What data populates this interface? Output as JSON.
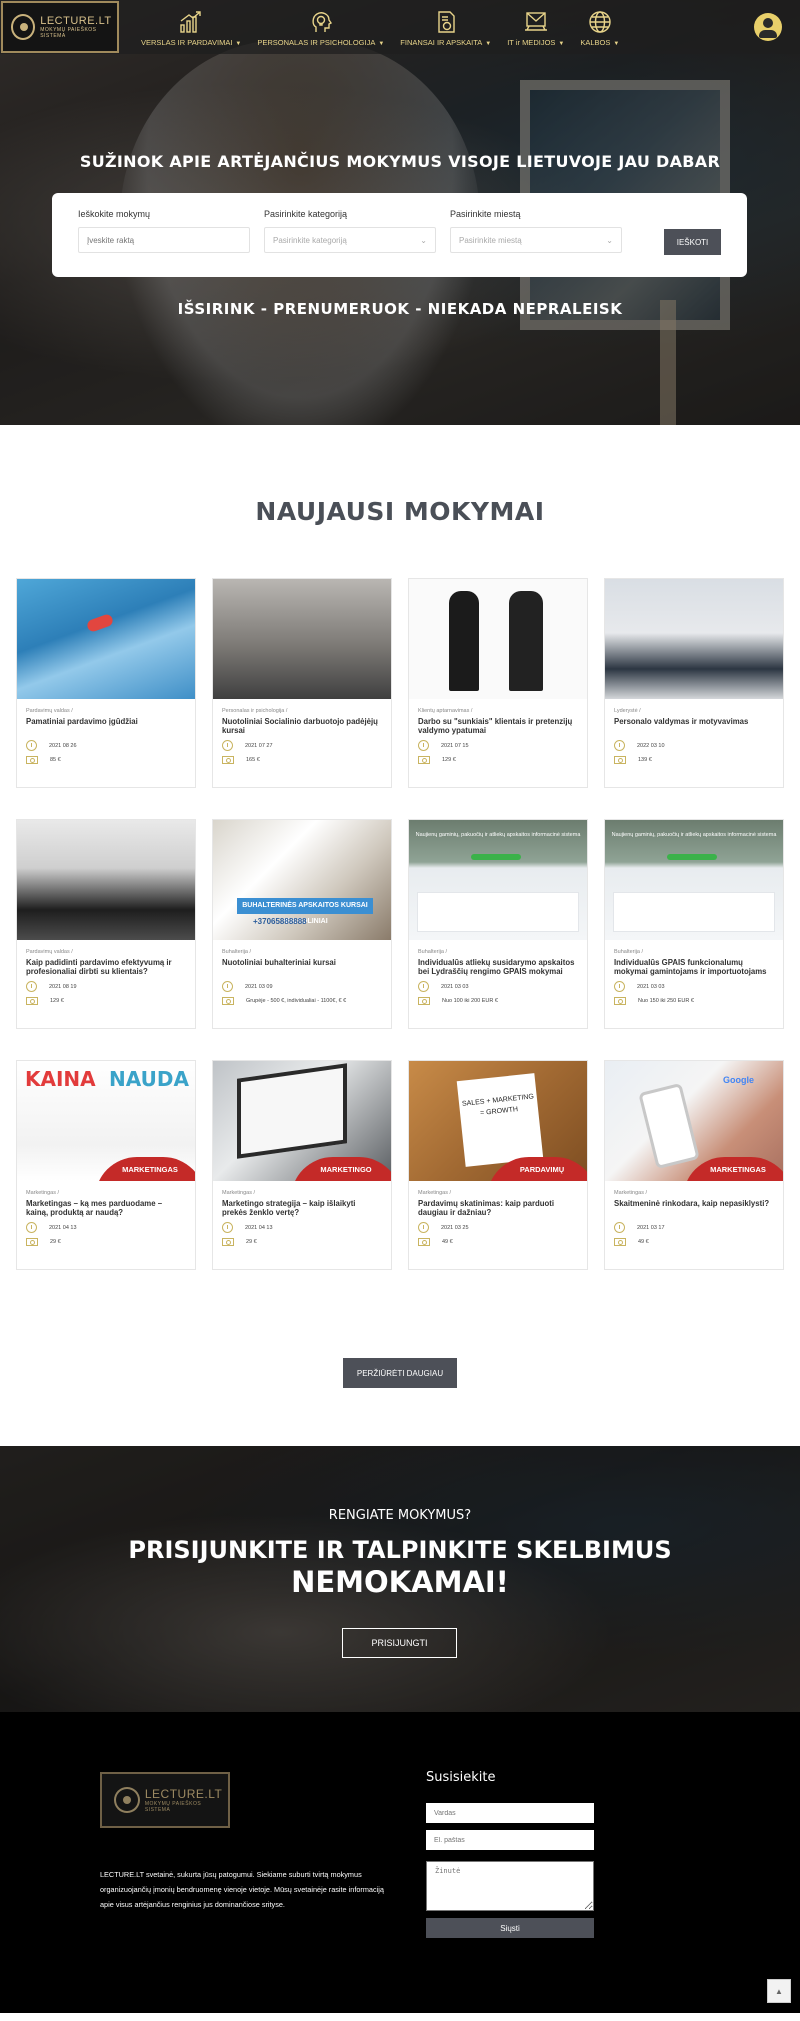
{
  "header": {
    "logo_text": "LECTURE.LT",
    "logo_tagline": "MOKYMŲ PAIEŠKOS SISTEMA",
    "nav": [
      {
        "label": "VERSLAS IR PARDAVIMAI",
        "icon": "chart-growth-icon"
      },
      {
        "label": "PERSONALAS IR PSICHOLOGIJA",
        "icon": "head-lightbulb-icon"
      },
      {
        "label": "FINANSAI IR APSKAITA",
        "icon": "document-money-icon"
      },
      {
        "label": "IT ir MEDIJOS",
        "icon": "laptop-envelope-icon"
      },
      {
        "label": "KALBOS",
        "icon": "globe-icon"
      }
    ],
    "user_icon": "user-account-icon"
  },
  "hero": {
    "title": "SUŽINOK APIE ARTĖJANČIUS MOKYMUS VISOJE LIETUVOJE JAU DABAR",
    "search": {
      "keyword_label": "Ieškokite mokymų",
      "keyword_placeholder": "Įveskite raktą",
      "category_label": "Pasirinkite kategoriją",
      "category_value": "Pasirinkite kategoriją",
      "city_label": "Pasirinkite miestą",
      "city_value": "Pasirinkite miestą",
      "button": "IEŠKOTI"
    },
    "subtitle": "IŠSIRINK - PRENUMERUOK - NIEKADA NEPRALEISK"
  },
  "latest": {
    "title": "NAUJAUSI MOKYMAI",
    "cards": [
      {
        "category": "Pardavimų valdas /",
        "title": "Pamatiniai pardavimo įgūdžiai",
        "date": "2021 08 26",
        "price": "85 €",
        "img": "stairs"
      },
      {
        "category": "Personalas ir psichologija /",
        "title": "Nuotoliniai Socialinio darbuotojo padėjėjų kursai",
        "date": "2021 07 27",
        "price": "165 €",
        "img": "group"
      },
      {
        "category": "Klientų aptarnavimas /",
        "title": "Darbo su \"sunkiais\" klientais ir pretenzijų valdymo ypatumai",
        "date": "2021 07 15",
        "price": "129 €",
        "img": "argue"
      },
      {
        "category": "Lyderystė /",
        "title": "Personalo valdymas ir motyvavimas",
        "date": "2022 03 10",
        "price": "139 €",
        "img": "meeting"
      },
      {
        "category": "Pardavimų valdas /",
        "title": "Kaip padidinti pardavimo efektyvumą ir profesionaliai dirbti su klientais?",
        "date": "2021 08 19",
        "price": "129 €",
        "img": "biz"
      },
      {
        "category": "Buhalterija /",
        "title": "Nuotoliniai buhalteriniai kursai",
        "date": "2021 03 09",
        "price": "Grupėje - 500 €, individualiai - 1100€, € €",
        "img": "office",
        "img_text": "BUHALTERINĖS APSKAITOS KURSAI NUOTOLINIAI",
        "img_phone": "+37065888888"
      },
      {
        "category": "Buhalterija /",
        "title": "Individualūs atliekų susidarymo apskaitos bei Lydraščių rengimo GPAIS mokymai",
        "date": "2021 03 03",
        "price": "Nuo 100 iki 200 EUR €",
        "img": "gpais",
        "img_text": "Naujienų gaminių, pakuočių ir atliekų apskaitos informacinė sistema"
      },
      {
        "category": "Buhalterija /",
        "title": "Individualūs GPAIS funkcionalumų mokymai gamintojams ir importuotojams",
        "date": "2021 03 03",
        "price": "Nuo 150 iki 250 EUR €",
        "img": "gpais",
        "img_text": "Naujienų gaminių, pakuočių ir atliekų apskaitos informacinė sistema"
      },
      {
        "category": "Marketingas /",
        "title": "Marketingas – ką mes parduodame – kainą, produktą ar naudą?",
        "date": "2021 04 13",
        "price": "29 €",
        "img": "kaina",
        "img_word1": "KAINA",
        "img_word2": "NAUDA",
        "ribbon": "MARKETINGAS"
      },
      {
        "category": "Marketingas /",
        "title": "Marketingo strategija – kaip išlaikyti prekės ženklo vertę?",
        "date": "2021 04 13",
        "price": "29 €",
        "img": "strat",
        "ribbon": "MARKETINGO"
      },
      {
        "category": "Marketingas /",
        "title": "Pardavimų skatinimas: kaip parduoti daugiau ir dažniau?",
        "date": "2021 03 25",
        "price": "49 €",
        "img": "sales",
        "img_text": "SALES + MARKETING = GROWTH",
        "ribbon": "PARDAVIMŲ"
      },
      {
        "category": "Marketingas /",
        "title": "Skaitmeninė rinkodara, kaip nepasiklysti?",
        "date": "2021 03 17",
        "price": "49 €",
        "img": "google",
        "img_text": "Google",
        "ribbon": "MARKETINGAS"
      }
    ],
    "more_button": "PERŽIŪRĖTI DAUGIAU"
  },
  "cta": {
    "small": "RENGIATE MOKYMUS?",
    "big_line1": "PRISIJUNKITE IR TALPINKITE SKELBIMUS",
    "big_line2": "NEMOKAMAI!",
    "button": "PRISIJUNGTI"
  },
  "footer": {
    "logo_text": "LECTURE.LT",
    "logo_tagline": "MOKYMŲ PAIEŠKOS SISTEMA",
    "description": "LECTURE.LT svetainė, sukurta jūsų patogumui. Siekiame suburti tvirtą mokymus organizuojančių įmonių bendruomenę vienoje vietoje. Mūsų svetainėje rasite informaciją apie visus artėjančius renginius jus dominančiose srityse.",
    "contact_title": "Susisiekite",
    "name_placeholder": "Vardas",
    "email_placeholder": "El. paštas",
    "message_placeholder": "Žinutė",
    "send_button": "Siųsti",
    "to_top_icon": "chevron-up-icon"
  }
}
